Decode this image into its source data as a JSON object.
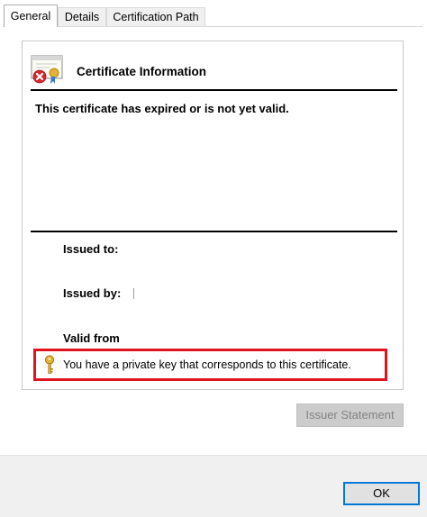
{
  "tabs": [
    {
      "label": "General",
      "active": true
    },
    {
      "label": "Details",
      "active": false
    },
    {
      "label": "Certification Path",
      "active": false
    }
  ],
  "panel": {
    "heading": "Certificate Information",
    "status_message": "This certificate has expired or is not yet valid.",
    "issued_to_label": "Issued to:",
    "issued_by_label": "Issued by:",
    "valid_from_label": "Valid from",
    "private_key_message": "You have a private key that corresponds to this certificate."
  },
  "buttons": {
    "issuer_statement": "Issuer Statement",
    "ok": "OK"
  },
  "colors": {
    "highlight_border": "#e0141e",
    "ok_border": "#0078d7",
    "error_icon": "#d9262e",
    "key_icon": "#e2b23a"
  },
  "icons": {
    "certificate": "certificate-error-icon",
    "key": "key-icon"
  }
}
